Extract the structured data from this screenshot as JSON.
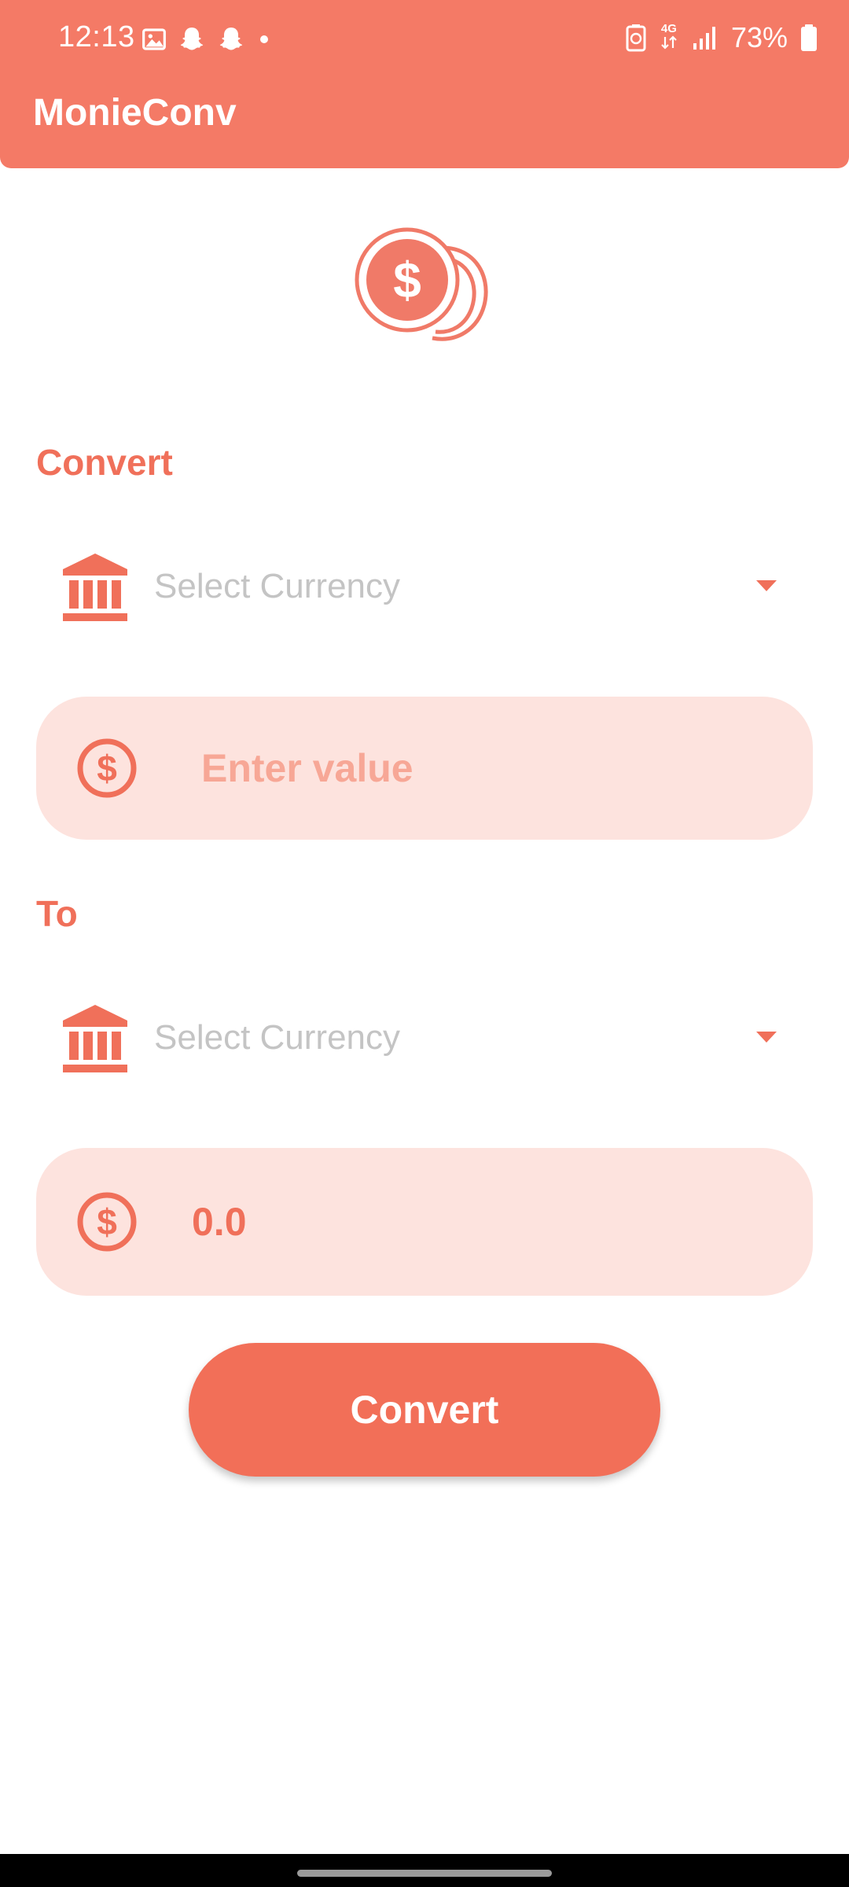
{
  "status_bar": {
    "time": "12:13",
    "network": "4G",
    "battery": "73%",
    "notification_icons": [
      "gallery-icon",
      "snapchat-icon",
      "snapchat-icon",
      "dot-icon"
    ]
  },
  "app": {
    "title": "MonieConv",
    "accent_color": "#f47a66"
  },
  "from": {
    "label": "Convert",
    "currency_placeholder": "Select Currency",
    "value_placeholder": "Enter value"
  },
  "to": {
    "label": "To",
    "currency_placeholder": "Select Currency",
    "value": "0.0"
  },
  "convert_button": {
    "label": "Convert"
  }
}
